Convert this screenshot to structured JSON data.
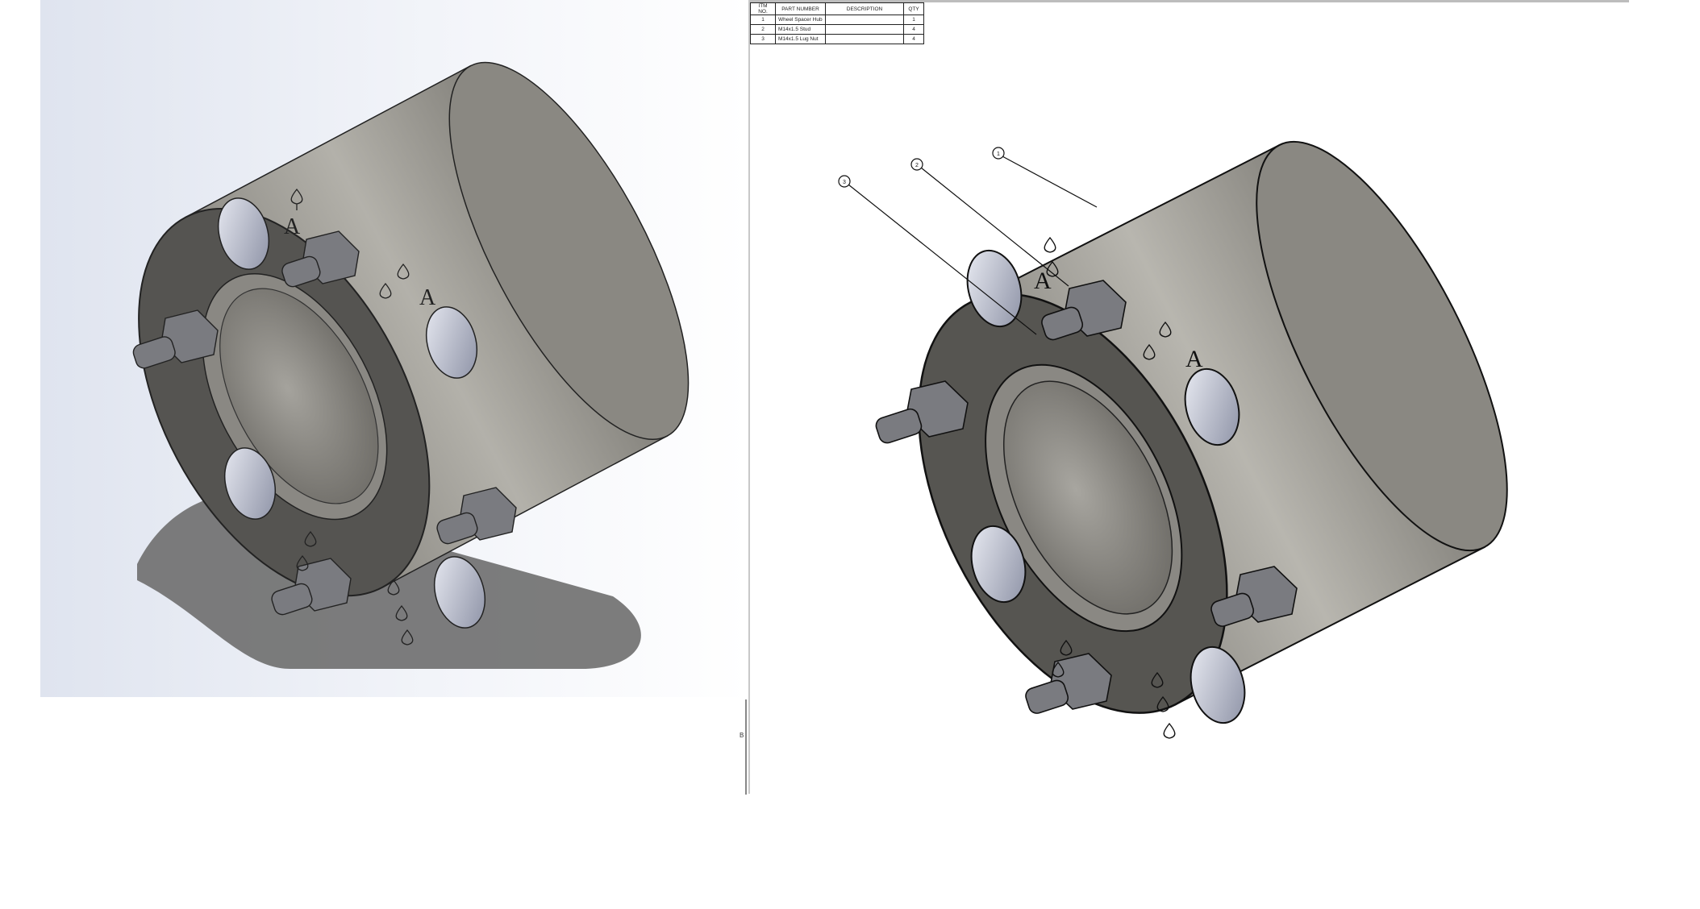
{
  "bom": {
    "headers": [
      "ITM NO.",
      "PART NUMBER",
      "DESCRIPTION",
      "QTY"
    ],
    "rows": [
      {
        "item": "1",
        "part": "Wheel Spacer Hub",
        "description": "",
        "qty": "1"
      },
      {
        "item": "2",
        "part": "M14x1.5 Stud",
        "description": "",
        "qty": "4"
      },
      {
        "item": "3",
        "part": "M14x1.5 Lug Nut",
        "description": "",
        "qty": "4"
      }
    ]
  },
  "balloons": [
    "1",
    "2",
    "3"
  ],
  "engraving": {
    "letter": "A",
    "suit": "spade"
  },
  "sheet_mark": "B",
  "colors": {
    "body": "#8c8a84",
    "face": "#555451",
    "hole": "#b8bccc",
    "metal": "#7a7b80",
    "background_blue": "#dfe4ef"
  }
}
